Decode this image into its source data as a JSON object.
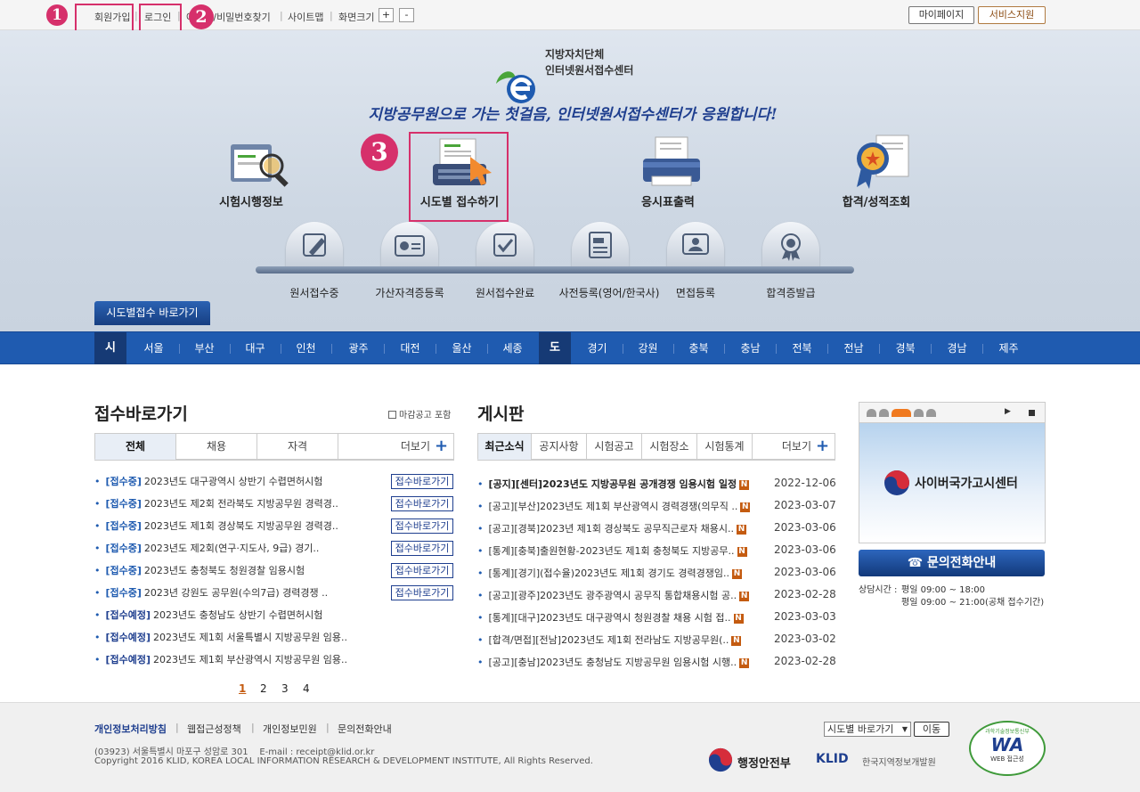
{
  "topbar": {
    "links": [
      "회원가입",
      "로그인",
      "아이디/비밀번호찾기",
      "사이트맵",
      "화면크기"
    ],
    "zoom_in": "+",
    "zoom_out": "-",
    "mypage": "마이페이지",
    "service": "서비스지원",
    "markers": [
      "1",
      "2",
      "3"
    ]
  },
  "hero": {
    "logo_line1": "지방자치단체",
    "logo_line2": "인터넷원서접수센터",
    "slogan": "지방공무원으로 가는 첫걸음, 인터넷원서접수센터가 응원합니다!",
    "main_menu": [
      "시험시행정보",
      "시도별 접수하기",
      "응시표출력",
      "합격/성적조회"
    ],
    "sub_menu": [
      "원서접수중",
      "가산자격증등록",
      "원서접수완료",
      "사전등록(영어/한국사)",
      "면접등록",
      "합격증발급"
    ],
    "quick_label": "시도별접수 바로가기"
  },
  "regions": {
    "si_label": "시",
    "si": [
      "서울",
      "부산",
      "대구",
      "인천",
      "광주",
      "대전",
      "울산",
      "세종"
    ],
    "do_label": "도",
    "do": [
      "경기",
      "강원",
      "충북",
      "충남",
      "전북",
      "전남",
      "경북",
      "경남",
      "제주"
    ]
  },
  "shortcut": {
    "title": "접수바로가기",
    "checkbox_label": "마감공고 포함",
    "tabs": [
      "전체",
      "채용",
      "자격"
    ],
    "more": "더보기",
    "go_label": "접수바로가기",
    "items": [
      {
        "status": "[접수중]",
        "text": "2023년도 대구광역시 상반기 수렵면허시험",
        "go": true
      },
      {
        "status": "[접수중]",
        "text": "2023년도 제2회 전라북도 지방공무원 경력경..",
        "go": true
      },
      {
        "status": "[접수중]",
        "text": "2023년도 제1회 경상북도 지방공무원 경력경..",
        "go": true
      },
      {
        "status": "[접수중]",
        "text": "2023년도 제2회(연구·지도사, 9급) 경기..",
        "go": true
      },
      {
        "status": "[접수중]",
        "text": "2023년도 충청북도 청원경찰 임용시험",
        "go": true
      },
      {
        "status": "[접수중]",
        "text": "2023년 강원도 공무원(수의7급) 경력경쟁 ..",
        "go": true
      },
      {
        "status": "[접수예정]",
        "text": "2023년도 충청남도 상반기 수렵면허시험",
        "go": false
      },
      {
        "status": "[접수예정]",
        "text": "2023년도 제1회 서울특별시 지방공무원 임용..",
        "go": false
      },
      {
        "status": "[접수예정]",
        "text": "2023년도 제1회 부산광역시 지방공무원 임용..",
        "go": false
      }
    ],
    "pages": [
      "1",
      "2",
      "3",
      "4"
    ]
  },
  "board": {
    "title": "게시판",
    "tabs": [
      "최근소식",
      "공지사항",
      "시험공고",
      "시험장소",
      "시험통계"
    ],
    "more": "더보기",
    "new_badge": "N",
    "items": [
      {
        "text": "[공지][센터]2023년도 지방공무원 공개경쟁 임용시험 일정",
        "date": "2022-12-06",
        "bold": true
      },
      {
        "text": "[공고][부산]2023년도 제1회 부산광역시 경력경쟁(의무직 ..",
        "date": "2023-03-07",
        "bold": false
      },
      {
        "text": "[공고][경북]2023년 제1회 경상북도 공무직근로자 채용시..",
        "date": "2023-03-06",
        "bold": false
      },
      {
        "text": "[통계][충북]출원현황-2023년도 제1회 충청북도 지방공무..",
        "date": "2023-03-06",
        "bold": false
      },
      {
        "text": "[통계][경기](접수율)2023년도 제1회 경기도 경력경쟁임..",
        "date": "2023-03-06",
        "bold": false
      },
      {
        "text": "[공고][광주]2023년도 광주광역시 공무직 통합채용시험 공..",
        "date": "2023-02-28",
        "bold": false
      },
      {
        "text": "[통계][대구]2023년도 대구광역시 청원경찰 채용 시험 접..",
        "date": "2023-03-03",
        "bold": false
      },
      {
        "text": "[합격/면접][전남]2023년도 제1회 전라남도 지방공무원(..",
        "date": "2023-03-02",
        "bold": false
      },
      {
        "text": "[공고][충남]2023년도 충청남도 지방공무원 임용시험 시행..",
        "date": "2023-02-28",
        "bold": false
      }
    ]
  },
  "right": {
    "banner_text": "사이버국가고시센터",
    "phone_btn": "☎ 문의전화안내",
    "hours_label": "상담시간 :",
    "hours1": "평일 09:00 ~ 18:00",
    "hours2": "평일 09:00 ~ 21:00(공채 접수기간)"
  },
  "footer": {
    "links": [
      "개인정보처리방침",
      "웹접근성정책",
      "개인정보민원",
      "문의전화안내"
    ],
    "address": "(03923) 서울특별시 마포구 성암로 301    E-mail : receipt@klid.or.kr",
    "copyright": "Copyright 2016 KLID, KOREA LOCAL INFORMATION RESEARCH & DEVELOPMENT INSTITUTE, All Rights Reserved.",
    "select_label": "시도별 바로가기",
    "go_btn": "이동",
    "org1": "행정안전부",
    "org2_brand": "KLID",
    "org2": "한국지역정보개발원",
    "wa_top": "과학기술정보통신부",
    "wa_mark": "WA",
    "wa_bottom": "WEB 접근성"
  },
  "colors": {
    "accent": "#1f5bb0",
    "highlight": "#d6306b",
    "new_badge": "#c45b10"
  }
}
